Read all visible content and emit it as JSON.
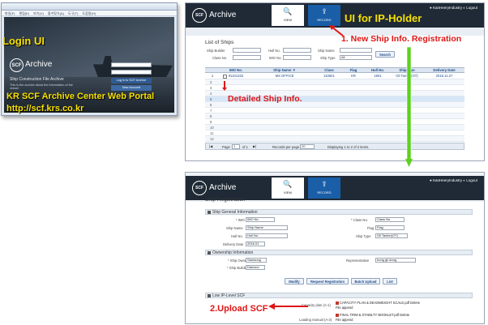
{
  "login_window": {
    "toolbar_items": [
      "파일(F)",
      "편집(E)",
      "보기(V)",
      "즐겨찾기(A)",
      "도구(T)",
      "도움말(H)"
    ],
    "label": "Login UI",
    "logo_circle": "SCF",
    "logo_text": "Archive",
    "subtitle": "Ship Construction File Archive",
    "description": "This is the archive about the information of the vessel.",
    "login_button": "Log in to SCF Archive",
    "new_account_button": "New Account",
    "portal_label": "KR SCF Archive Center Web Portal",
    "portal_url": "http://scf.krs.co.kr"
  },
  "header": {
    "logo_circle": "SCF",
    "logo_text": "Archive",
    "tab_view": "VIEW",
    "tab_record": "RECORD",
    "user": "● KanHeeryIndustry  ◐ Logout"
  },
  "frame1": {
    "annotation_title": "UI for IP-Holder",
    "annotation_new": "1. New Ship Info. Registration",
    "annotation_detail": "Detailed Ship Info.",
    "list_title": "List of Ships",
    "filters": {
      "ship_builder": "Ship Builder",
      "hull_no": "Hull No.",
      "ship_name": "Ship Name",
      "class_no": "Class No.",
      "imo_no": "IMO No.",
      "ship_type": "Ship Type",
      "ship_type_value": "All",
      "search_button": "Search"
    },
    "columns": [
      "",
      "IMO No.",
      "Ship Name ▼",
      "Class",
      "Flag",
      "Hull No.",
      "Ship type",
      "Delivery Date"
    ],
    "rows": [
      {
        "index": "1",
        "imo": "91101332",
        "name": "MS OFFICE",
        "class": "110821",
        "flag": "KR",
        "hull": "1801",
        "type": "Oil Tanker(OT)",
        "delivery": "2016.11.27"
      }
    ],
    "row_numbers": [
      "1",
      "2",
      "3",
      "4",
      "5",
      "6",
      "7",
      "8",
      "9",
      "10",
      "11",
      "12"
    ],
    "pager": {
      "page_label": "Page",
      "page_value": "1",
      "of_label": "of 1",
      "records_label": "Records per page",
      "records_value": "20",
      "displaying": "Displaying 1 to 2 of 2 items."
    }
  },
  "frame2": {
    "title": "Ship Registration",
    "general_section": "Ship General Information",
    "imo_label": "* IMO No.",
    "imo_value": "IMO No",
    "class_label": "* Class No.",
    "class_value": "Class No",
    "ship_name_label": "Ship Name",
    "ship_name_value": "Ship Name",
    "flag_label": "Flag",
    "flag_value": "Flag",
    "hull_label": "Hull No.",
    "hull_value": "Hull No",
    "ship_type_label": "Ship Type",
    "ship_type_value": "Oil Tanker(OT)",
    "delivery_label": "Delivery Date",
    "delivery_value": "2016.01",
    "ownership_section": "Ownership Information",
    "owner_label": "* Ship Owner",
    "owner_value": "Samsung",
    "rep_label": "Representative",
    "rep_value": "hong gil dong",
    "builder_label": "* Ship Builder",
    "builder_value": "Daewoo",
    "buttons": [
      "Modify",
      "Request Registration",
      "Batch Upload",
      "List"
    ],
    "low_section": "Low IP-Level SCF",
    "capacity_label": "Capacity plan (A-1)",
    "capacity_file": "CAPACITY PLAN & DEADWEIGHT SCALE.pdf",
    "loading_label": "Loading manual (A-2)",
    "loading_file": "FINAL TRIM & STABILTY BOOKLET.pdf",
    "delete_label": "Delete",
    "file_append": "File append",
    "annotation_upload": "2.Upload SCF"
  },
  "colors": {
    "header_bg": "#1f2a36",
    "accent_blue": "#1a5ea8",
    "annotation_red": "#e01414",
    "annotation_yellow": "#f6e000",
    "arrow_green": "#5bd11d"
  }
}
